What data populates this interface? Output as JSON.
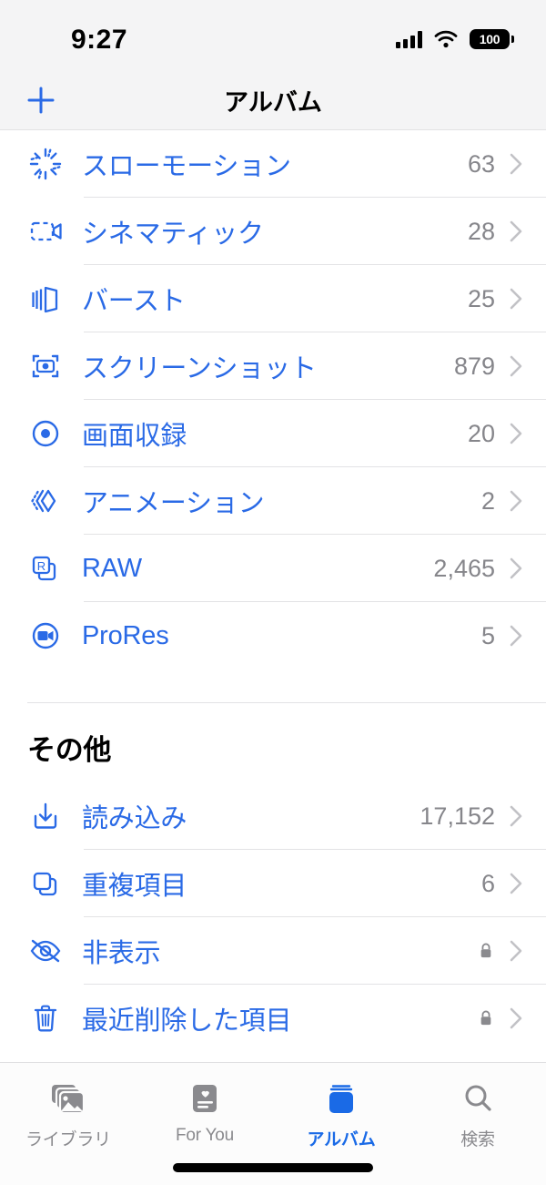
{
  "status_bar": {
    "time": "9:27",
    "battery_level": "100",
    "signal_icon": "cellular-signal-icon",
    "wifi_icon": "wifi-icon",
    "battery_icon": "battery-icon"
  },
  "nav": {
    "title": "アルバム",
    "add_icon": "plus-icon"
  },
  "media_types": {
    "rows": [
      {
        "icon": "slow-motion-icon",
        "label": "スローモーション",
        "count": "63"
      },
      {
        "icon": "cinematic-video-icon",
        "label": "シネマティック",
        "count": "28"
      },
      {
        "icon": "burst-icon",
        "label": "バースト",
        "count": "25"
      },
      {
        "icon": "screenshot-icon",
        "label": "スクリーンショット",
        "count": "879"
      },
      {
        "icon": "screen-recording-icon",
        "label": "画面収録",
        "count": "20"
      },
      {
        "icon": "animation-icon",
        "label": "アニメーション",
        "count": "2"
      },
      {
        "icon": "raw-icon",
        "label": "RAW",
        "count": "2,465"
      },
      {
        "icon": "prores-icon",
        "label": "ProRes",
        "count": "5"
      }
    ]
  },
  "other_section": {
    "header": "その他",
    "rows": [
      {
        "icon": "import-icon",
        "label": "読み込み",
        "count": "17,152",
        "locked": false
      },
      {
        "icon": "duplicates-icon",
        "label": "重複項目",
        "count": "6",
        "locked": false
      },
      {
        "icon": "hidden-icon",
        "label": "非表示",
        "count": "",
        "locked": true
      },
      {
        "icon": "trash-icon",
        "label": "最近削除した項目",
        "count": "",
        "locked": true
      }
    ]
  },
  "tabbar": {
    "tabs": [
      {
        "icon": "library-icon",
        "label": "ライブラリ",
        "active": false
      },
      {
        "icon": "for-you-icon",
        "label": "For You",
        "active": false
      },
      {
        "icon": "albums-icon",
        "label": "アルバム",
        "active": true
      },
      {
        "icon": "search-icon",
        "label": "検索",
        "active": false
      }
    ]
  },
  "colors": {
    "accent_blue": "#2a6ae6",
    "tab_active_blue": "#1a6ae6",
    "secondary_gray": "#86868b",
    "separator": "#e3e3e5",
    "bar_background": "#f4f4f5"
  }
}
